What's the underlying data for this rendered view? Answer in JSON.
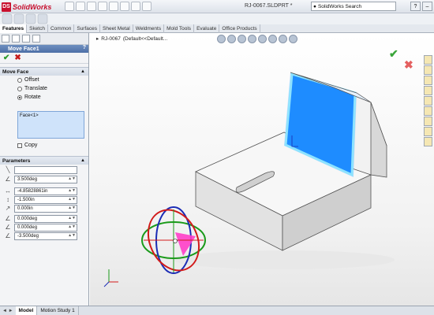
{
  "app": {
    "brand": "SolidWorks",
    "doc_title": "RJ-0067.SLDPRT *",
    "search_placeholder": "SolidWorks Search"
  },
  "tabs": [
    "Features",
    "Sketch",
    "Common",
    "Surfaces",
    "Sheet Metal",
    "Weldments",
    "Mold Tools",
    "Evaluate",
    "Office Products"
  ],
  "active_tab": "Features",
  "crumb": {
    "part": "RJ-0067",
    "config": "(Default<<Default..."
  },
  "property_manager": {
    "title": "Move Face1",
    "help": "?",
    "group_move": "Move Face",
    "options": [
      "Offset",
      "Translate",
      "Rotate"
    ],
    "selected_option": "Rotate",
    "selection": "Face<1>",
    "copy_label": "Copy",
    "group_params": "Parameters",
    "params": [
      "3.500deg",
      "-4.85828861in",
      "-1.500in",
      "0.000in",
      "0.000deg",
      "0.000deg",
      "-3.500deg"
    ]
  },
  "bottom_tabs": [
    "Model",
    "Motion Study 1"
  ],
  "active_bottom": "Model",
  "colors": {
    "face_highlight": "#1e8cff",
    "ok": "#2a9a2a",
    "cancel": "#c61a1a",
    "pm_header": "#5a7bb0"
  }
}
